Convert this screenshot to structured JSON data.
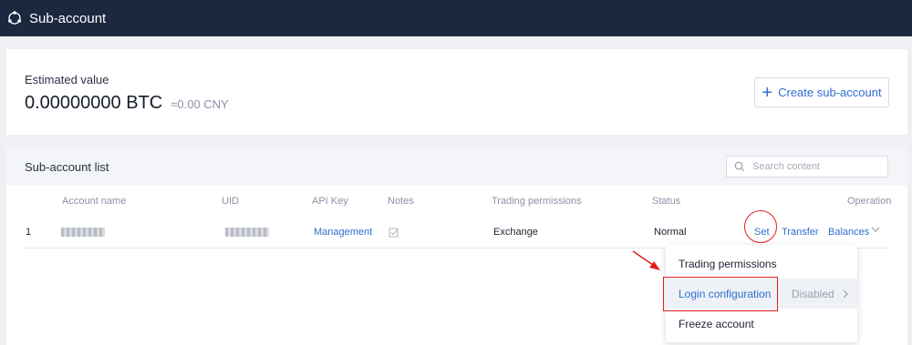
{
  "header": {
    "title": "Sub-account"
  },
  "summary": {
    "estimated_label": "Estimated value",
    "btc_value": "0.00000000 BTC",
    "cny_value": "≈0.00 CNY",
    "create_button": "Create sub-account"
  },
  "list": {
    "title": "Sub-account list",
    "search_placeholder": "Search content",
    "columns": [
      "Account name",
      "UID",
      "API Key",
      "Notes",
      "Trading permissions",
      "Status",
      "Operation"
    ],
    "rows": [
      {
        "index": "1",
        "api_key": "Management",
        "trading_permissions": "Exchange",
        "status": "Normal",
        "actions": {
          "set": "Set",
          "transfer": "Transfer",
          "balances": "Balances"
        }
      }
    ]
  },
  "dropdown": {
    "items": [
      {
        "label": "Trading permissions"
      },
      {
        "label": "Login configuration",
        "sub": "Disabled"
      },
      {
        "label": "Freeze account"
      }
    ]
  },
  "colors": {
    "header_bg": "#1c2840",
    "accent": "#2f6fcf",
    "annotation": "#e02020"
  }
}
